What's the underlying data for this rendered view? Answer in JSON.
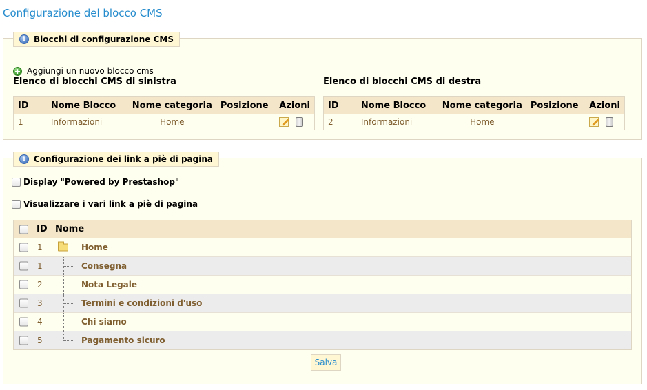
{
  "page_title": "Configurazione del blocco CMS",
  "cms_section": {
    "legend": "Blocchi di configurazione CMS",
    "add_link": "Aggiungi un nuovo blocco cms",
    "left": {
      "title": "Elenco di blocchi CMS di sinistra",
      "headers": [
        "ID",
        "Nome Blocco",
        "Nome categoria",
        "Posizione",
        "Azioni"
      ],
      "rows": [
        {
          "id": "1",
          "name": "Informazioni",
          "category": "Home",
          "position": ""
        }
      ]
    },
    "right": {
      "title": "Elenco di blocchi CMS di destra",
      "headers": [
        "ID",
        "Nome Blocco",
        "Nome categoria",
        "Posizione",
        "Azioni"
      ],
      "rows": [
        {
          "id": "2",
          "name": "Informazioni",
          "category": "Home",
          "position": ""
        }
      ]
    },
    "icons": {
      "info": "info-icon",
      "add": "add-icon",
      "edit": "edit-icon",
      "delete": "trash-icon"
    }
  },
  "footer_section": {
    "legend": "Configurazione dei link a piè di pagina",
    "powered_label": "Display \"Powered by Prestashop\"",
    "footer_links_label": "Visualizzare i vari link a piè di pagina",
    "table_headers": {
      "id": "ID",
      "name": "Nome"
    },
    "rows": [
      {
        "id": "1",
        "name": "Home",
        "is_root": true
      },
      {
        "id": "1",
        "name": "Consegna"
      },
      {
        "id": "2",
        "name": "Nota Legale"
      },
      {
        "id": "3",
        "name": "Termini e condizioni d'uso"
      },
      {
        "id": "4",
        "name": "Chi siamo"
      },
      {
        "id": "5",
        "name": "Pagamento sicuro"
      }
    ],
    "save_label": "Salva"
  },
  "colors": {
    "title": "#268ccd",
    "link_text": "#7f5e2f",
    "panel_bg": "#fffff0",
    "header_bg": "#f4e6c9"
  }
}
